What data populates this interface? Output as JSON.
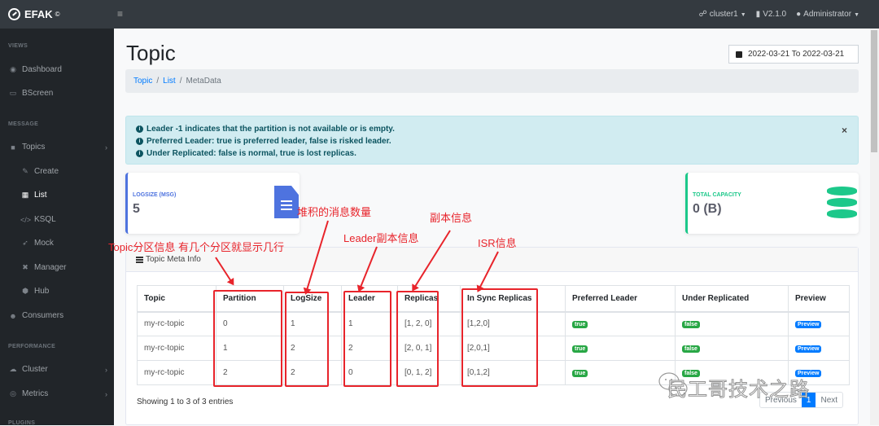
{
  "app": {
    "name": "EFAK",
    "mark": "©"
  },
  "topnav": {
    "cluster": "cluster1",
    "version": "V2.1.0",
    "user": "Administrator"
  },
  "sidebar": {
    "sections": [
      {
        "heading": "VIEWS",
        "items": [
          {
            "label": "Dashboard",
            "icon": "dashboard-icon"
          },
          {
            "label": "BScreen",
            "icon": "desktop-icon"
          }
        ]
      },
      {
        "heading": "MESSAGE",
        "items": [
          {
            "label": "Topics",
            "icon": "comment-icon",
            "expandable": true,
            "children": [
              {
                "label": "Create",
                "icon": "edit-icon"
              },
              {
                "label": "List",
                "icon": "table-icon",
                "active": true
              },
              {
                "label": "KSQL",
                "icon": "code-icon"
              },
              {
                "label": "Mock",
                "icon": "paper-plane-icon"
              },
              {
                "label": "Manager",
                "icon": "tools-icon"
              },
              {
                "label": "Hub",
                "icon": "cube-icon"
              }
            ]
          },
          {
            "label": "Consumers",
            "icon": "users-icon"
          }
        ]
      },
      {
        "heading": "PERFORMANCE",
        "items": [
          {
            "label": "Cluster",
            "icon": "cloud-icon",
            "expandable": true
          },
          {
            "label": "Metrics",
            "icon": "eye-icon",
            "expandable": true
          }
        ]
      },
      {
        "heading": "PLUGINS",
        "items": []
      }
    ]
  },
  "page": {
    "title": "Topic",
    "date_range": "2022-03-21 To 2022-03-21",
    "breadcrumb": [
      "Topic",
      "List",
      "MetaData"
    ]
  },
  "alert": {
    "lines": [
      "Leader -1 indicates that the partition is not available or is empty.",
      "Preferred Leader: true is preferred leader, false is risked leader.",
      "Under Replicated: false is normal, true is lost replicas."
    ],
    "close": "×"
  },
  "cards": {
    "logsize": {
      "label": "LOGSIZE (MSG)",
      "value": "5",
      "color": "#4e73df"
    },
    "capacity": {
      "label": "TOTAL CAPACITY",
      "value": "0 (B)",
      "color": "#1cc88a"
    }
  },
  "meta_panel": {
    "title": "Topic Meta Info",
    "columns": [
      "Topic",
      "Partition",
      "LogSize",
      "Leader",
      "Replicas",
      "In Sync Replicas",
      "Preferred Leader",
      "Under Replicated",
      "Preview"
    ],
    "rows": [
      {
        "topic": "my-rc-topic",
        "partition": "0",
        "logsize": "1",
        "leader": "1",
        "replicas": "[1, 2, 0]",
        "isr": "[1,2,0]",
        "preferred": "true",
        "under": "false",
        "preview": "Preview"
      },
      {
        "topic": "my-rc-topic",
        "partition": "1",
        "logsize": "2",
        "leader": "2",
        "replicas": "[2, 0, 1]",
        "isr": "[2,0,1]",
        "preferred": "true",
        "under": "false",
        "preview": "Preview"
      },
      {
        "topic": "my-rc-topic",
        "partition": "2",
        "logsize": "2",
        "leader": "0",
        "replicas": "[0, 1, 2]",
        "isr": "[0,1,2]",
        "preferred": "true",
        "under": "false",
        "preview": "Preview"
      }
    ],
    "showing": "Showing 1 to 3 of 3 entries",
    "pager": {
      "prev": "Previous",
      "current": "1",
      "next": "Next"
    }
  },
  "annotations": {
    "partition": "Topic分区信息 有几个分区就显示几行",
    "logsize": "堆积的消息数量",
    "leader": "Leader副本信息",
    "replicas": "副本信息",
    "isr": "ISR信息"
  },
  "watermark": "民工哥技术之路"
}
